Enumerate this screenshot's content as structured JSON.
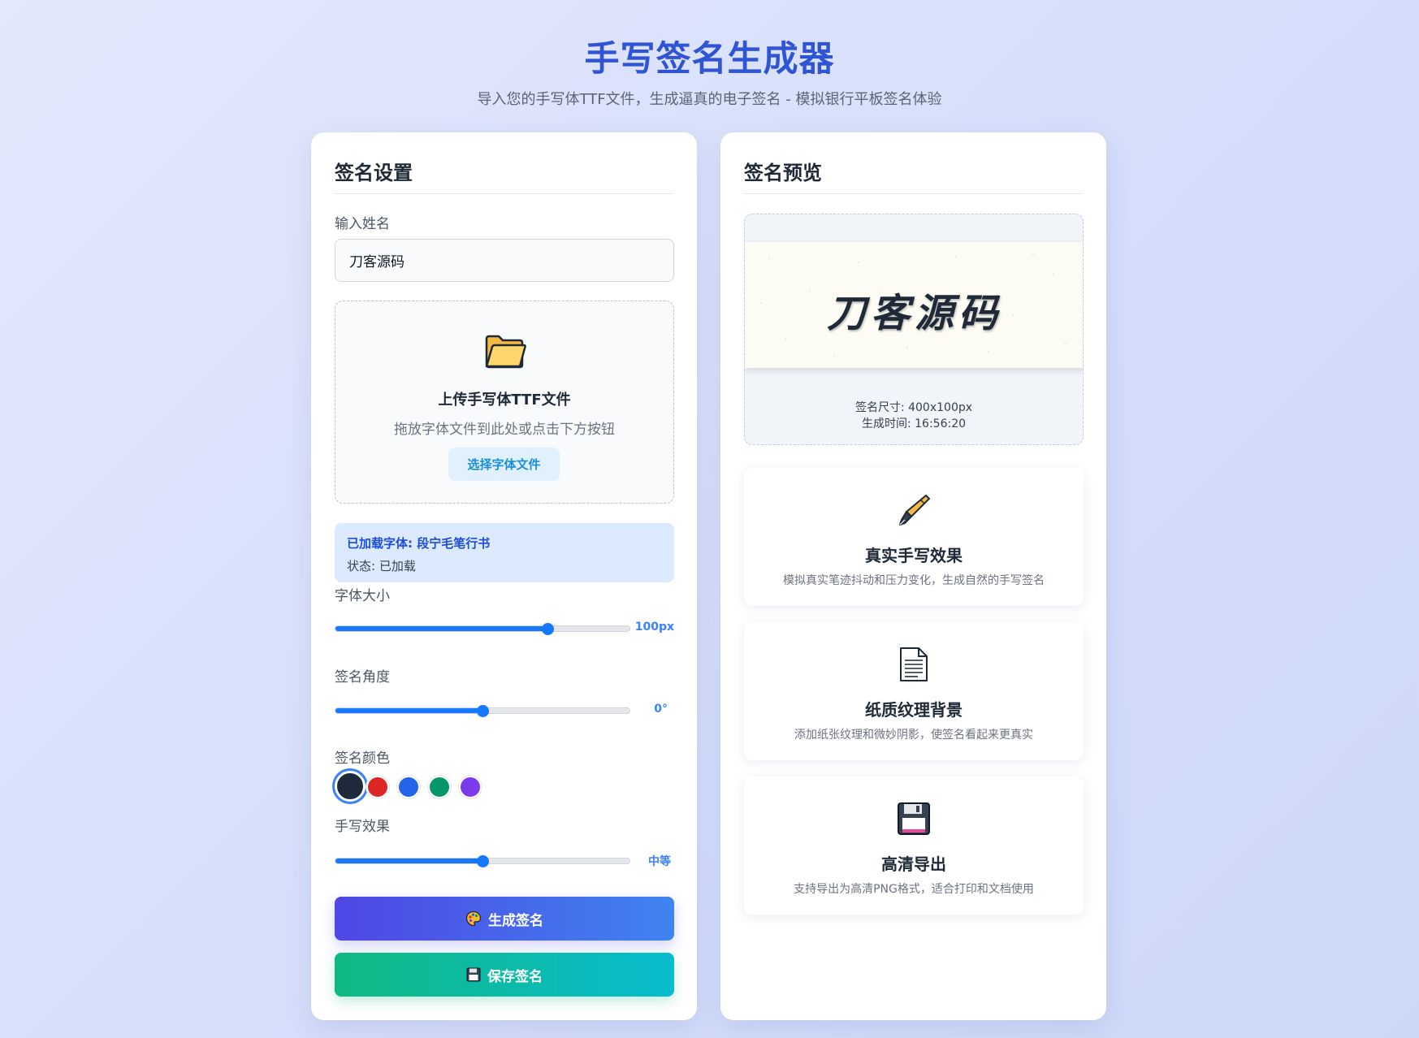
{
  "header": {
    "title": "手写签名生成器",
    "subtitle": "导入您的手写体TTF文件，生成逼真的电子签名 - 模拟银行平板签名体验"
  },
  "settings": {
    "title": "签名设置",
    "name_label": "输入姓名",
    "name_value": "刀客源码",
    "upload": {
      "icon": "folder-icon",
      "title": "上传手写体TTF文件",
      "hint": "拖放字体文件到此处或点击下方按钮",
      "button_label": "选择字体文件"
    },
    "font_status": {
      "name": "已加载字体: 段宁毛笔行书",
      "state": "状态: 已加载"
    },
    "font_size": {
      "label": "字体大小",
      "value": "100px",
      "fraction": 0.72
    },
    "angle": {
      "label": "签名角度",
      "value": "0°",
      "fraction": 0.5
    },
    "color": {
      "label": "签名颜色",
      "options": [
        "#1e293b",
        "#dc2626",
        "#2563eb",
        "#059669",
        "#7c3aed"
      ],
      "selected_index": 0
    },
    "effect": {
      "label": "手写效果",
      "value": "中等",
      "fraction": 0.5
    },
    "generate_button": {
      "icon": "palette-icon",
      "label": "生成签名"
    },
    "save_button": {
      "icon": "floppy-disk-icon",
      "label": "保存签名"
    }
  },
  "preview": {
    "title": "签名预览",
    "signature_text": "刀客源码",
    "size_text": "签名尺寸: 400x100px",
    "time_text": "生成时间: 16:56:20"
  },
  "features": [
    {
      "icon": "fountain-pen-icon",
      "title": "真实手写效果",
      "desc": "模拟真实笔迹抖动和压力变化，生成自然的手写签名"
    },
    {
      "icon": "page-icon",
      "title": "纸质纹理背景",
      "desc": "添加纸张纹理和微妙阴影，使签名看起来更真实"
    },
    {
      "icon": "floppy-disk-icon",
      "title": "高清导出",
      "desc": "支持导出为高清PNG格式，适合打印和文档使用"
    }
  ]
}
